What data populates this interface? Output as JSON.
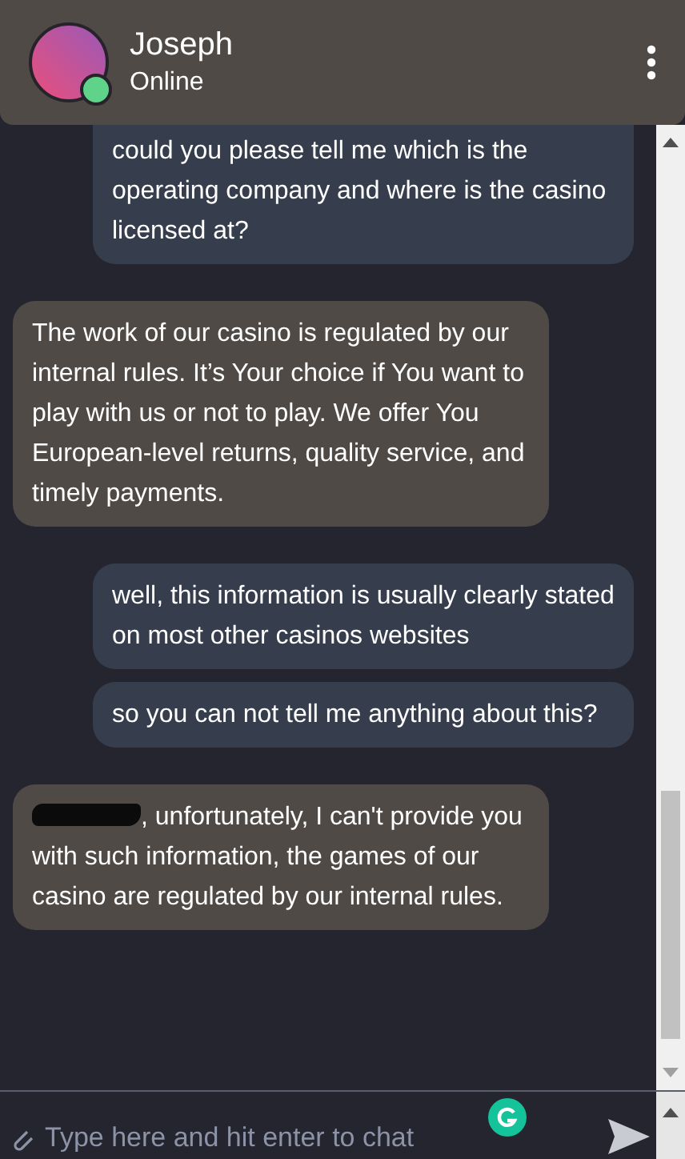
{
  "header": {
    "name": "Joseph",
    "status": "Online",
    "online": true
  },
  "messages": [
    {
      "kind": "user",
      "text": "could you please tell me which is the operating company and where is the casino licensed at?"
    },
    {
      "kind": "agent",
      "text": "The work of our casino is regulated by our internal rules. It’s Your choice if You want to play with us or not to play. We offer You European-level returns, quality service, and timely payments."
    },
    {
      "kind": "user",
      "text": "well, this information is usually clearly stated on most other casinos websites"
    },
    {
      "kind": "user",
      "text": "so you can not tell me anything about this?"
    },
    {
      "kind": "agent",
      "redacted": true,
      "text": ", unfortunately, I can't provide you with such information, the games of our casino are regulated by our internal rules."
    }
  ],
  "composer": {
    "placeholder": "Type here and hit enter to chat"
  }
}
